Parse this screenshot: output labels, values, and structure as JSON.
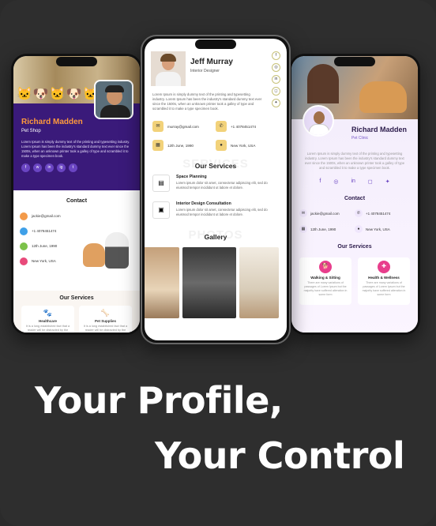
{
  "left_phone": {
    "name": "Richard Madden",
    "role": "Pet Shop",
    "description": "Lorem Ipsum is simply dummy text of the printing and typesetting industry. Lorem Ipsum has been the industry's standard dummy text ever since the 1500s, when an unknown printer took a galley of type and scrambled it to make a type specimen book.",
    "social": [
      "f",
      "w",
      "in",
      "ig",
      "t"
    ],
    "contact_title": "Contact",
    "contact": [
      {
        "value": "jackie@gmail.com",
        "color": "#f39a4a"
      },
      {
        "value": "+1 4078451474",
        "color": "#3fa0e8"
      },
      {
        "value": "12th June, 1990",
        "color": "#7cc24a"
      },
      {
        "value": "New York, USA",
        "color": "#e84a7a"
      }
    ],
    "services_title": "Our Services",
    "services": [
      {
        "title": "Healthcare",
        "desc": "It is a long established fact that a reader will be distracted by the"
      },
      {
        "title": "Pet Supplies",
        "desc": "It is a long established fact that a reader will be distracted by the"
      }
    ]
  },
  "center_phone": {
    "name": "Jeff Murray",
    "role": "Interior Designer",
    "description": "Lorem Ipsum is simply dummy text of the printing and typesetting industry. Lorem Ipsum has been the industry's standard dummy text ever since the 1500s, when an unknown printer took a galley of type and scrambled it to make a type specimen book.",
    "contact": [
      {
        "value": "murray@gmail.com"
      },
      {
        "value": "+1 4078451474"
      },
      {
        "value": "12th June, 1990"
      },
      {
        "value": "New York, USA"
      }
    ],
    "services_ghost": "SERVICES",
    "services_title": "Our Services",
    "services": [
      {
        "title": "Space Planning",
        "desc": "Lorem ipsum dolor sit amet, consectetur adipiscing elit, sed do eiusmod tempor incididunt ut labore et dolore."
      },
      {
        "title": "Interior Design Consultation",
        "desc": "Lorem ipsum dolor sit amet, consectetur adipiscing elit, sed do eiusmod tempor incididunt ut labore et dolore."
      }
    ],
    "gallery_ghost": "PHOTOS",
    "gallery_title": "Gallery"
  },
  "right_phone": {
    "name": "Richard Madden",
    "role": "Pet Clinic",
    "description": "Lorem Ipsum is simply dummy text of the printing and typesetting industry. Lorem Ipsum has been the industry's standard dummy text ever since the 1500s, when an unknown printer took a galley of type and scrambled it to make a type specimen book.",
    "contact_title": "Contact",
    "contact": [
      {
        "value": "jackie@gmail.com"
      },
      {
        "value": "+1 4078451474"
      },
      {
        "value": "12th June, 1990"
      },
      {
        "value": "New York, USA"
      }
    ],
    "services_title": "Our Services",
    "services": [
      {
        "title": "Walking & Sitting",
        "desc": "There are many variations of passages of Lorem Ipsum but the majority have suffered alteration in some form"
      },
      {
        "title": "Health & Wellness",
        "desc": "There are many variations of passages of Lorem Ipsum but the majority have suffered alteration in some form"
      }
    ]
  },
  "tagline": {
    "line1": "Your Profile,",
    "line2": "Your Control"
  },
  "colors": {
    "background": "#2e2e2e",
    "left_accent": "#3a1a7a",
    "left_name": "#ff9a3c",
    "center_accent": "#f2d27a",
    "right_accent": "#6a45c2",
    "right_service_icon": "#e83e8c"
  }
}
